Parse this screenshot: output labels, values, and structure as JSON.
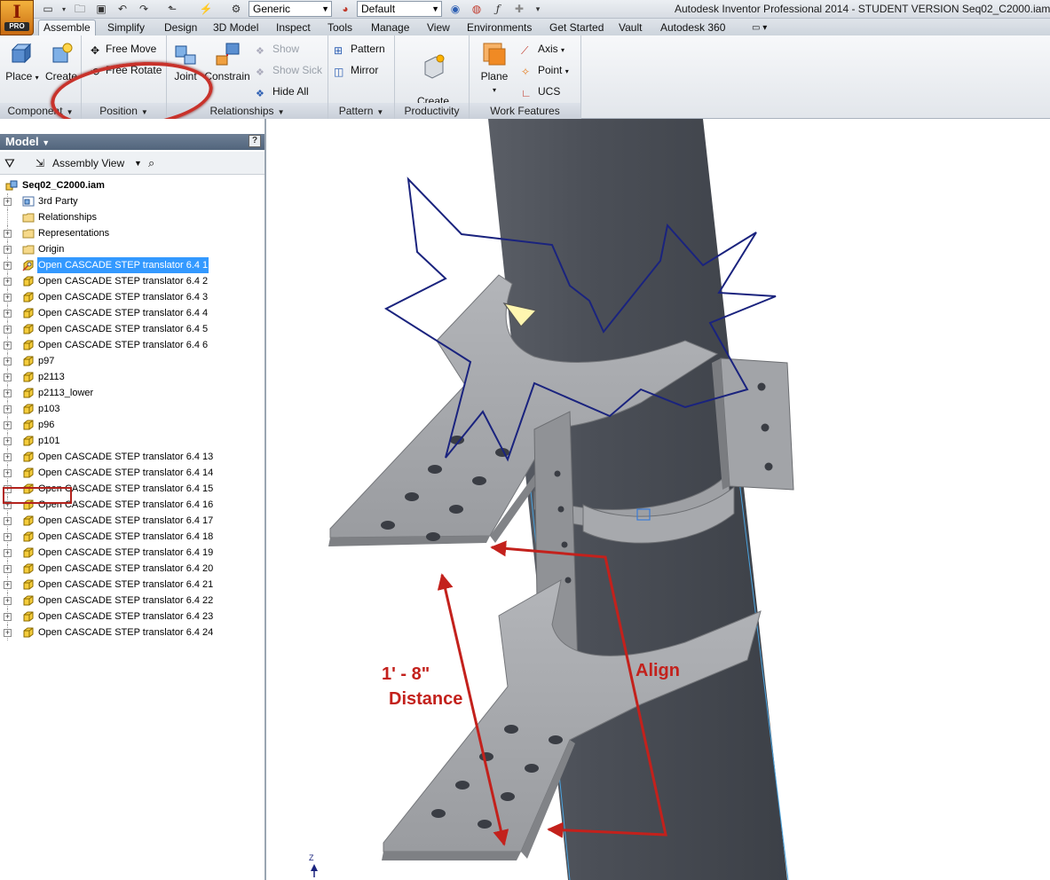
{
  "titlebar": {
    "app_letter": "I",
    "app_badge": "PRO",
    "material_combo": "Generic",
    "appearance_combo": "Default",
    "title": "Autodesk Inventor Professional 2014 - STUDENT VERSION    Seq02_C2000.iam",
    "qat_icons": [
      "new-icon",
      "open-icon",
      "save-icon",
      "undo-icon",
      "redo-icon",
      "return-icon",
      "update-icon",
      "project-icon",
      "color-wheel-icon",
      "material-sphere-icon",
      "appearance-override-icon",
      "clear-appearance-icon",
      "fx-icon",
      "plus-icon",
      "customize-icon"
    ]
  },
  "tabs": [
    "Assemble",
    "Simplify",
    "Design",
    "3D Model",
    "Inspect",
    "Tools",
    "Manage",
    "View",
    "Environments",
    "Get Started",
    "Vault",
    "Autodesk 360"
  ],
  "active_tab": "Assemble",
  "ribbon": {
    "component": {
      "title": "Component",
      "place": "Place",
      "create": "Create"
    },
    "position": {
      "title": "Position",
      "free_move": "Free Move",
      "free_rotate": "Free Rotate"
    },
    "relationships": {
      "title": "Relationships",
      "joint": "Joint",
      "constrain": "Constrain",
      "show": "Show",
      "show_sick": "Show Sick",
      "hide_all": "Hide All"
    },
    "pattern": {
      "title": "Pattern",
      "pattern": "Pattern",
      "mirror": "Mirror"
    },
    "productivity": {
      "title": "Productivity",
      "create_substitutes": "Create\nSubstitutes"
    },
    "work_features": {
      "title": "Work Features",
      "plane": "Plane",
      "axis": "Axis",
      "point": "Point",
      "ucs": "UCS"
    }
  },
  "browser": {
    "title": "Model",
    "help": "?",
    "view_combo": "Assembly View",
    "root": "Seq02_C2000.iam",
    "nodes": [
      {
        "label": "3rd Party",
        "icon": "third-party-icon",
        "expandable": true
      },
      {
        "label": "Relationships",
        "icon": "folder-icon",
        "expandable": false
      },
      {
        "label": "Representations",
        "icon": "folder-icon",
        "expandable": true
      },
      {
        "label": "Origin",
        "icon": "folder-icon",
        "expandable": true
      },
      {
        "label": "Open CASCADE STEP translator 6.4 1",
        "icon": "grounded-part-icon",
        "expandable": true,
        "selected": true
      },
      {
        "label": "Open CASCADE STEP translator 6.4 2",
        "icon": "part-icon",
        "expandable": true
      },
      {
        "label": "Open CASCADE STEP translator 6.4 3",
        "icon": "part-icon",
        "expandable": true
      },
      {
        "label": "Open CASCADE STEP translator 6.4 4",
        "icon": "part-icon",
        "expandable": true
      },
      {
        "label": "Open CASCADE STEP translator 6.4 5",
        "icon": "part-icon",
        "expandable": true
      },
      {
        "label": "Open CASCADE STEP translator 6.4 6",
        "icon": "part-icon",
        "expandable": true
      },
      {
        "label": "p97",
        "icon": "part-icon",
        "expandable": true
      },
      {
        "label": "p2113",
        "icon": "part-icon",
        "expandable": true,
        "highlighted": true
      },
      {
        "label": "p2113_lower",
        "icon": "part-icon",
        "expandable": true
      },
      {
        "label": "p103",
        "icon": "part-icon",
        "expandable": true
      },
      {
        "label": "p96",
        "icon": "part-icon",
        "expandable": true
      },
      {
        "label": "p101",
        "icon": "part-icon",
        "expandable": true
      },
      {
        "label": "Open CASCADE STEP translator 6.4 13",
        "icon": "part-icon",
        "expandable": true
      },
      {
        "label": "Open CASCADE STEP translator 6.4 14",
        "icon": "part-icon",
        "expandable": true
      },
      {
        "label": "Open CASCADE STEP translator 6.4 15",
        "icon": "part-icon",
        "expandable": true
      },
      {
        "label": "Open CASCADE STEP translator 6.4 16",
        "icon": "part-icon",
        "expandable": true
      },
      {
        "label": "Open CASCADE STEP translator 6.4 17",
        "icon": "part-icon",
        "expandable": true
      },
      {
        "label": "Open CASCADE STEP translator 6.4 18",
        "icon": "part-icon",
        "expandable": true
      },
      {
        "label": "Open CASCADE STEP translator 6.4 19",
        "icon": "part-icon",
        "expandable": true
      },
      {
        "label": "Open CASCADE STEP translator 6.4 20",
        "icon": "part-icon",
        "expandable": true
      },
      {
        "label": "Open CASCADE STEP translator 6.4 21",
        "icon": "part-icon",
        "expandable": true
      },
      {
        "label": "Open CASCADE STEP translator 6.4 22",
        "icon": "part-icon",
        "expandable": true
      },
      {
        "label": "Open CASCADE STEP translator 6.4 23",
        "icon": "part-icon",
        "expandable": true
      },
      {
        "label": "Open CASCADE STEP translator 6.4 24",
        "icon": "part-icon",
        "expandable": true
      }
    ]
  },
  "viewport": {
    "annotation_distance_value": "1' - 8\"",
    "annotation_distance_label": "Distance",
    "annotation_align": "Align",
    "triad_axis_label": "Z"
  },
  "colors": {
    "annotation_red": "#c3211c",
    "starburst_blue": "#1a237e",
    "selection_blue": "#3399ff",
    "part_gray": "#a2a4a8",
    "pipe_dark": "#4b4f57"
  }
}
